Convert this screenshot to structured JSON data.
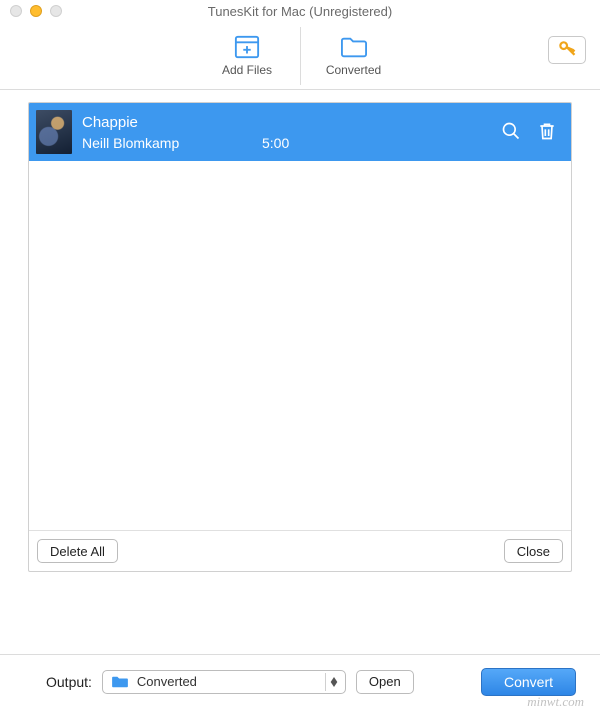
{
  "window": {
    "title": "TunesKit for Mac (Unregistered)"
  },
  "toolbar": {
    "add_files_label": "Add Files",
    "converted_label": "Converted"
  },
  "list": {
    "items": [
      {
        "title": "Chappie",
        "author": "Neill Blomkamp",
        "duration": "5:00"
      }
    ]
  },
  "panel": {
    "delete_all_label": "Delete All",
    "close_label": "Close"
  },
  "output": {
    "label": "Output:",
    "selected": "Converted",
    "open_label": "Open",
    "convert_label": "Convert"
  },
  "watermark": "minwt.com"
}
